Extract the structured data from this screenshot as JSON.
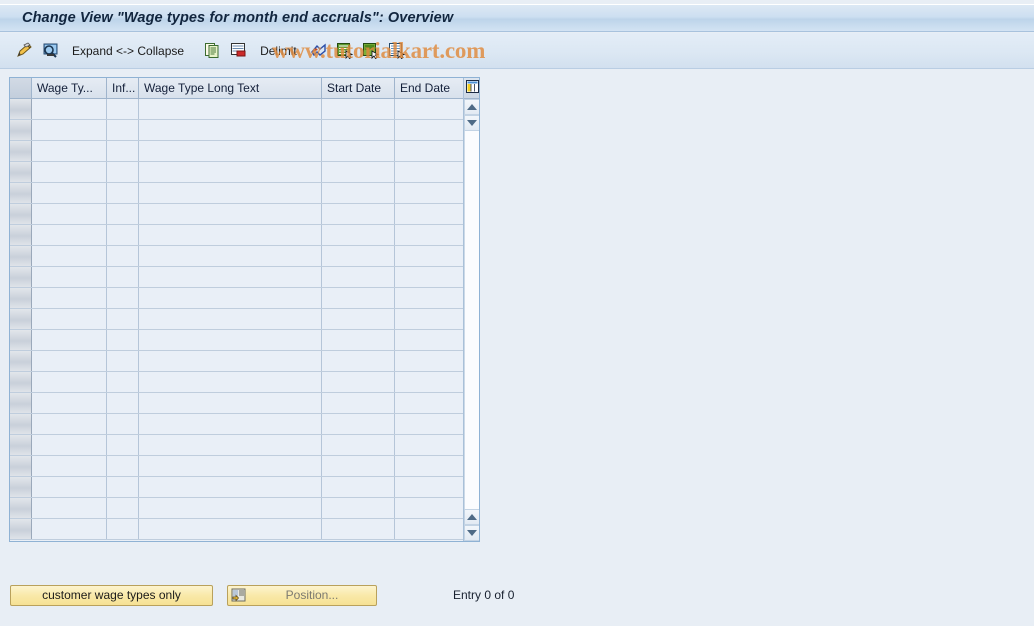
{
  "window": {
    "title": "Change View \"Wage types for month end accruals\": Overview"
  },
  "toolbar": {
    "items": [
      {
        "name": "display-change-icon",
        "icon": "pencil-icon",
        "label": ""
      },
      {
        "name": "display-details-icon",
        "icon": "magnifier-screen-icon",
        "label": ""
      },
      {
        "name": "expand-collapse-button",
        "icon": "",
        "label": "Expand <-> Collapse"
      },
      {
        "name": "copy-as-icon",
        "icon": "copy-icon",
        "label": ""
      },
      {
        "name": "delete-icon",
        "icon": "delete-row-icon",
        "label": ""
      },
      {
        "name": "delimit-button",
        "icon": "",
        "label": "Delimit"
      },
      {
        "name": "undo-icon",
        "icon": "undo-arrow-icon",
        "label": ""
      },
      {
        "name": "select-all-icon",
        "icon": "select-all-icon",
        "label": ""
      },
      {
        "name": "select-block-icon",
        "icon": "select-block-icon",
        "label": ""
      },
      {
        "name": "deselect-all-icon",
        "icon": "deselect-all-icon",
        "label": ""
      }
    ]
  },
  "watermark": {
    "text": "www.tutorialkart.com",
    "color": "#e08a3c"
  },
  "table": {
    "columns": [
      {
        "key": "select",
        "label": ""
      },
      {
        "key": "wage_type",
        "label": "Wage Ty..."
      },
      {
        "key": "infotype",
        "label": "Inf..."
      },
      {
        "key": "long_text",
        "label": "Wage Type Long Text"
      },
      {
        "key": "start_date",
        "label": "Start Date"
      },
      {
        "key": "end_date",
        "label": "End Date"
      }
    ],
    "rows": [],
    "empty_row_count": 21,
    "config_icon": "table-settings-icon",
    "scroll": {
      "up_icon": "scroll-up-icon",
      "down_icon": "scroll-down-icon"
    }
  },
  "footer": {
    "customer_wage_types_button": "customer wage types only",
    "position_button": "Position...",
    "position_icon": "position-icon",
    "entry_status": "Entry 0 of 0"
  },
  "colors": {
    "background": "#e8eef5",
    "accent_yellow": "#f6e194",
    "grid_border": "#8fb2d4",
    "title_text": "#12263f"
  }
}
